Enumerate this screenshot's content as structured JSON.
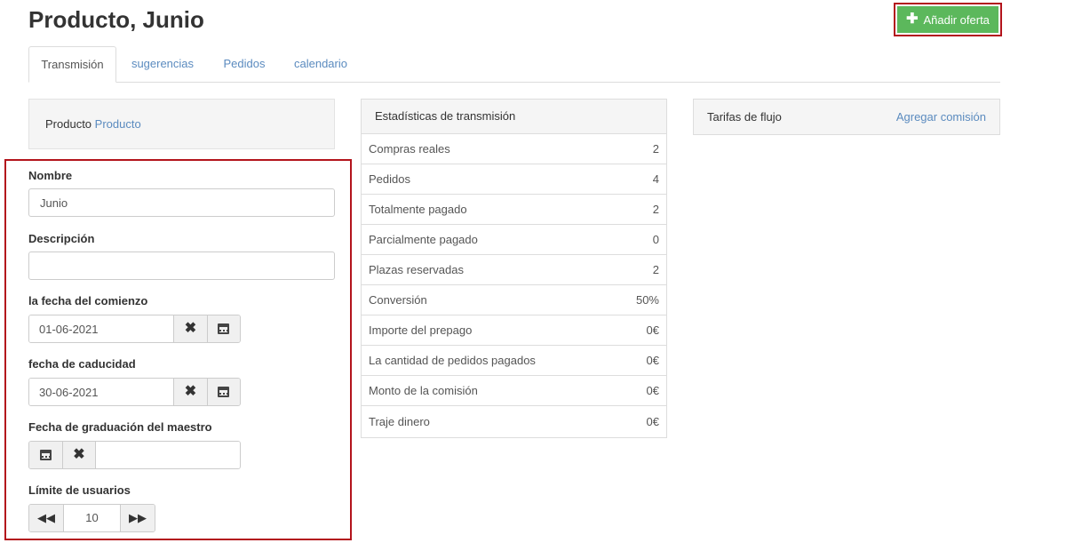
{
  "page": {
    "title": "Producto, Junio"
  },
  "header": {
    "add_offer_label": "Añadir oferta"
  },
  "tabs": [
    {
      "label": "Transmisión",
      "active": true
    },
    {
      "label": "sugerencias",
      "active": false
    },
    {
      "label": "Pedidos",
      "active": false
    },
    {
      "label": "calendario",
      "active": false
    }
  ],
  "product_panel": {
    "label": "Producto",
    "link": "Producto"
  },
  "form": {
    "name": {
      "label": "Nombre",
      "value": "Junio"
    },
    "description": {
      "label": "Descripción",
      "value": ""
    },
    "start_date": {
      "label": "la fecha del comienzo",
      "value": "01-06-2021"
    },
    "end_date": {
      "label": "fecha de caducidad",
      "value": "30-06-2021"
    },
    "master_graduation": {
      "label": "Fecha de graduación del maestro",
      "value": ""
    },
    "user_limit": {
      "label": "Límite de usuarios",
      "value": "10"
    }
  },
  "stats": {
    "title": "Estadísticas de transmisión",
    "rows": [
      {
        "label": "Compras reales",
        "value": "2"
      },
      {
        "label": "Pedidos",
        "value": "4"
      },
      {
        "label": "Totalmente pagado",
        "value": "2"
      },
      {
        "label": "Parcialmente pagado",
        "value": "0"
      },
      {
        "label": "Plazas reservadas",
        "value": "2"
      },
      {
        "label": "Conversión",
        "value": "50%"
      },
      {
        "label": "Importe del prepago",
        "value": "0€"
      },
      {
        "label": "La cantidad de pedidos pagados",
        "value": "0€"
      },
      {
        "label": "Monto de la comisión",
        "value": "0€"
      },
      {
        "label": "Traje dinero",
        "value": "0€"
      }
    ]
  },
  "fees": {
    "title": "Tarifas de flujo",
    "add_link": "Agregar comisión"
  },
  "colors": {
    "accent_link": "#5b8bbf",
    "success": "#5cb85c",
    "highlight": "#b3141c"
  },
  "icons": [
    "plus-icon",
    "times-icon",
    "calendar-icon",
    "fast-backward-icon",
    "fast-forward-icon"
  ]
}
